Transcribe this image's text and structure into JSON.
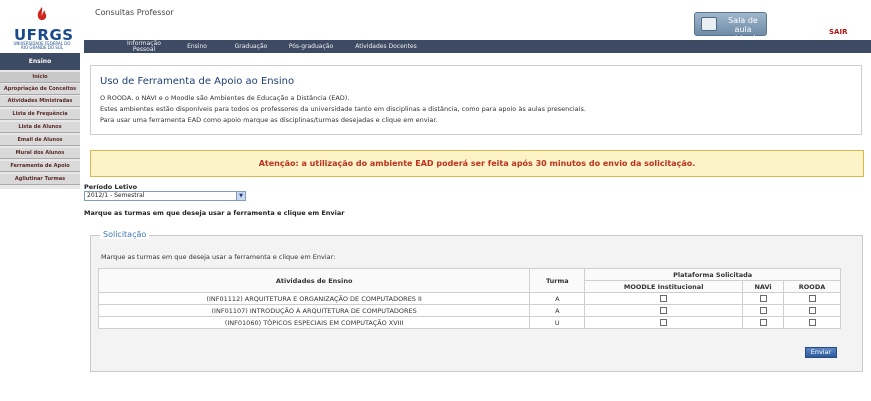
{
  "header": {
    "logo_text": "UFRGS",
    "logo_subtitle": "UNIVERSIDADE FEDERAL DO RIO GRANDE DO SUL",
    "app_title": "Consultas Professor",
    "sala_virtual_label": "Sala de aula virtual",
    "logout_label": "SAIR"
  },
  "topnav": [
    "Informação Pessoal",
    "Ensino",
    "Graduação",
    "Pós-graduação",
    "Atividades Docentes"
  ],
  "sidebar": {
    "title": "Ensino",
    "items": [
      "Início",
      "Apropriação de Conceitos",
      "Atividades Ministradas",
      "Lista de Frequência",
      "Lista de Alunos",
      "Email de Alunos",
      "Mural dos Alunos",
      "Ferramenta de Apoio",
      "Agliutinar Turmas"
    ]
  },
  "intro": {
    "title": "Uso de Ferramenta de Apoio ao Ensino",
    "lines": [
      "O ROODA, o NAVI e o Moodle são Ambientes de Educação a Distância (EAD).",
      "Estes ambientes estão disponíveis para todos os professores da universidade tanto em disciplinas a distância, como para apoio às aulas presenciais.",
      "Para usar uma ferramenta EAD como apoio marque as disciplinas/turmas desejadas e clique em enviar."
    ]
  },
  "warning": "Atenção: a utilização do ambiente EAD poderá ser feita após 30 minutos do envio da solicitação.",
  "periodo": {
    "label": "Período Letivo",
    "selected": "2012/1 - Semestral"
  },
  "instruction_outer": "Marque as turmas em que deseja usar a ferramenta e clique em Enviar",
  "solicitacao": {
    "legend": "Solicitação",
    "instruction": "Marque as turmas em que deseja usar a ferramenta e clique em Enviar:",
    "headers": {
      "atividades": "Atividades de Ensino",
      "turma": "Turma",
      "plataforma": "Plataforma Solicitada",
      "moodle": "MOODLE Institucional",
      "navi": "NAVi",
      "rooda": "ROODA"
    },
    "rows": [
      {
        "atividade": "(INF01112) ARQUITETURA E ORGANIZAÇÃO DE COMPUTADORES II",
        "turma": "A",
        "moodle": false,
        "navi": false,
        "rooda": false
      },
      {
        "atividade": "(INF01107) INTRODUÇÃO À ARQUITETURA DE COMPUTADORES",
        "turma": "A",
        "moodle": false,
        "navi": false,
        "rooda": false
      },
      {
        "atividade": "(INF01060) TÓPICOS ESPECIAIS EM COMPUTAÇÃO XVIII",
        "turma": "U",
        "moodle": false,
        "navi": false,
        "rooda": false
      }
    ],
    "submit_label": "Enviar"
  },
  "colors": {
    "nav_bg": "#3c4a63",
    "accent_blue": "#1e3f72",
    "warning_text": "#c0301e",
    "warning_bg": "#fcf4c8"
  }
}
